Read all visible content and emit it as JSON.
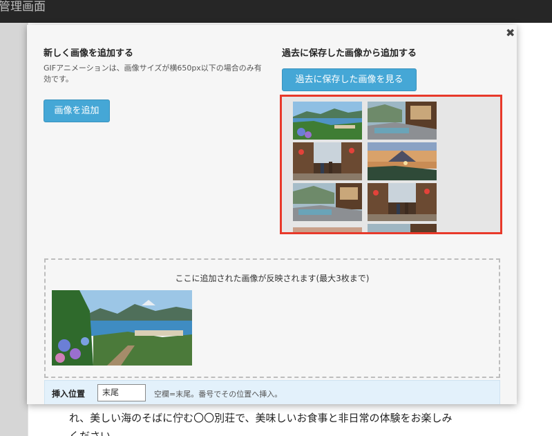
{
  "app": {
    "title": "管理画面"
  },
  "background": {
    "line1": "れ、美しい海のそばに佇む〇〇別荘で、美味しいお食事と非日常の体験をお楽しみ",
    "line2": "ください。"
  },
  "modal": {
    "close_icon": "close-icon",
    "new_image": {
      "heading": "新しく画像を追加する",
      "description": "GIFアニメーションは、画像サイズが横650px以下の場合のみ有効です。",
      "add_button": "画像を追加"
    },
    "saved_images": {
      "heading": "過去に保存した画像から追加する",
      "view_button": "過去に保存した画像を見る",
      "thumbnails": [
        {
          "name": "coastal-town-hydrangea"
        },
        {
          "name": "onsen-footbath-river"
        },
        {
          "name": "market-street-lanterns"
        },
        {
          "name": "mountain-sunset-bay"
        },
        {
          "name": "onsen-footbath-river"
        },
        {
          "name": "market-street-lanterns"
        },
        {
          "name": "sunset-partial"
        },
        {
          "name": "onsen-partial"
        }
      ]
    },
    "drop_area": {
      "label": "ここに追加された画像が反映されます(最大3枚まで)",
      "images": [
        {
          "name": "coastal-town-hydrangea"
        }
      ]
    },
    "insert": {
      "label": "挿入位置",
      "value": "末尾",
      "hint": "空欄=末尾。番号でその位置へ挿入。"
    }
  }
}
